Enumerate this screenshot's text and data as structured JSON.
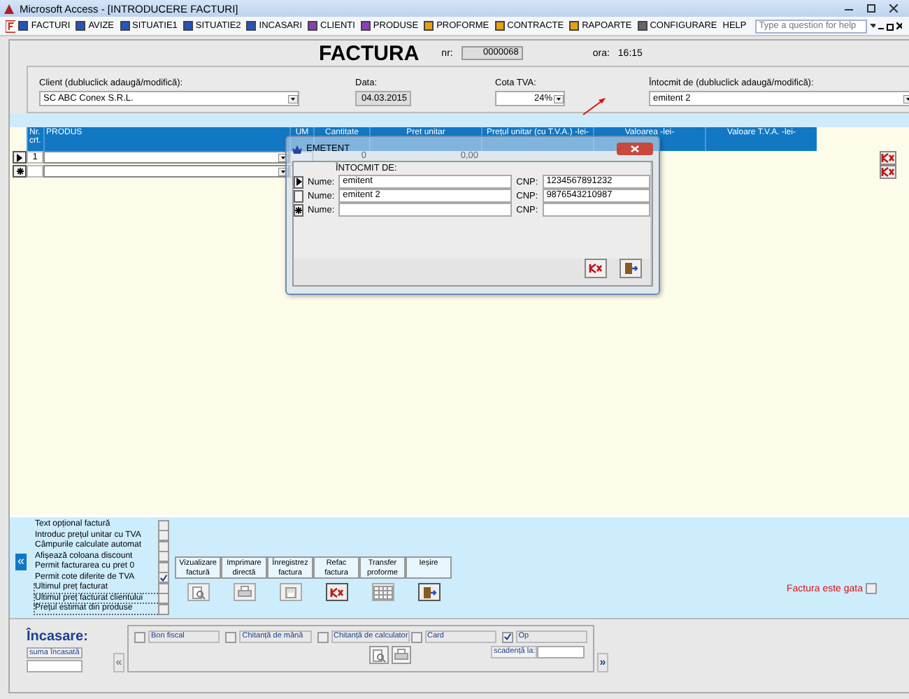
{
  "window": {
    "title": "Microsoft Access - [INTRODUCERE FACTURI]"
  },
  "menu": [
    {
      "label": "FACTURI",
      "color": "#2255c4"
    },
    {
      "label": "AVIZE",
      "color": "#2255c4"
    },
    {
      "label": "SITUATIE1",
      "color": "#2255c4"
    },
    {
      "label": "SITUATIE2",
      "color": "#2255c4"
    },
    {
      "label": "INCASARI",
      "color": "#2255c4"
    },
    {
      "label": "CLIENTI",
      "color": "#8a3fb8"
    },
    {
      "label": "PRODUSE",
      "color": "#8a3fb8"
    },
    {
      "label": "PROFORME",
      "color": "#e8a010"
    },
    {
      "label": "CONTRACTE",
      "color": "#e8a010"
    },
    {
      "label": "RAPOARTE",
      "color": "#e8a010"
    },
    {
      "label": "CONFIGURARE",
      "color": "#666666"
    },
    {
      "label": "HELP"
    }
  ],
  "help_box": {
    "placeholder": "Type a question for help"
  },
  "header": {
    "title": "FACTURA",
    "nr_label": "nr:",
    "nr": "0000068",
    "ora_label": "ora:",
    "ora": "16:15"
  },
  "fields": [
    {
      "label": "Client (dubluclick adaugă/modifică):",
      "value": "SC ABC Conex S.R.L.",
      "kind": "combo"
    },
    {
      "label": "Data:",
      "value": "04.03.2015",
      "kind": "date"
    },
    {
      "label": "Cota TVA:",
      "value": "24%",
      "kind": "combo"
    },
    {
      "label": "Întocmit de (dubluclick adaugă/modifică):",
      "value": "emitent 2",
      "kind": "combo"
    }
  ],
  "table": {
    "columns": [
      "Nr. crt.",
      "PRODUS",
      "UM",
      "Cantitate",
      "Pret unitar",
      "Prețul unitar (cu T.V.A.) -lei-",
      "Valoarea -lei-",
      "Valoare T.V.A. -lei-"
    ],
    "rows": [
      {
        "kind": "current",
        "nr": "1",
        "quantity": "0",
        "price": "0,00"
      },
      {
        "kind": "new"
      }
    ]
  },
  "dialog": {
    "title": "EMETENT",
    "heading": "ÎNTOCMIT DE:",
    "rows": [
      {
        "kind": "current",
        "name_label": "Nume:",
        "name": "emitent",
        "cnp_label": "CNP:",
        "cnp": "1234567891232"
      },
      {
        "kind": "normal",
        "name_label": "Nume:",
        "name": "emitent 2",
        "cnp_label": "CNP:",
        "cnp": "9876543210987"
      },
      {
        "kind": "new",
        "name_label": "Nume:",
        "cnp_label": "CNP:"
      }
    ]
  },
  "collapse_button": "«",
  "options": [
    {
      "label": "Text opțional factură",
      "checked": false,
      "grouped": false
    },
    {
      "label": "Introduc prețul unitar cu TVA",
      "checked": false,
      "grouped": false
    },
    {
      "label": "Câmpurile calculate automat",
      "checked": false,
      "grouped": false
    },
    {
      "label": "Afișează coloana discount",
      "checked": false,
      "grouped": false
    },
    {
      "label": "Permit facturarea cu pret 0",
      "checked": false,
      "grouped": false
    },
    {
      "label": "Permit cote diferite de TVA",
      "checked": true,
      "grouped": false
    },
    {
      "label": "Ultimul preț facturat",
      "checked": false,
      "grouped": true
    },
    {
      "label": "Ultimul preț facturat clientului",
      "checked": false,
      "grouped": true
    },
    {
      "label": "Prețul estimat din produse",
      "checked": false,
      "grouped": true
    }
  ],
  "actions": [
    {
      "label": "Vizualizare factură",
      "kind": "preview"
    },
    {
      "label": "Imprimare directă",
      "kind": "print"
    },
    {
      "label": "Înregistrez factura",
      "kind": "save"
    },
    {
      "label": "Refac factura",
      "kind": "delete"
    },
    {
      "label": "Transfer proforme",
      "kind": "grid"
    },
    {
      "label": "Ieșire",
      "kind": "exit"
    }
  ],
  "ready": {
    "label": "Factura este gata",
    "checked": false
  },
  "payment": {
    "title": "Încasare:",
    "sum_label": "suma încasată",
    "prev": "«",
    "next": "»",
    "methods": [
      {
        "label": "Bon fiscal",
        "checked": false
      },
      {
        "label": "Chitanță de mână",
        "checked": false
      },
      {
        "label": "Chitanță de calculator",
        "checked": false
      },
      {
        "label": "Card",
        "checked": false
      },
      {
        "label": "Op",
        "checked": true
      }
    ],
    "due_label": "scadență la:"
  }
}
